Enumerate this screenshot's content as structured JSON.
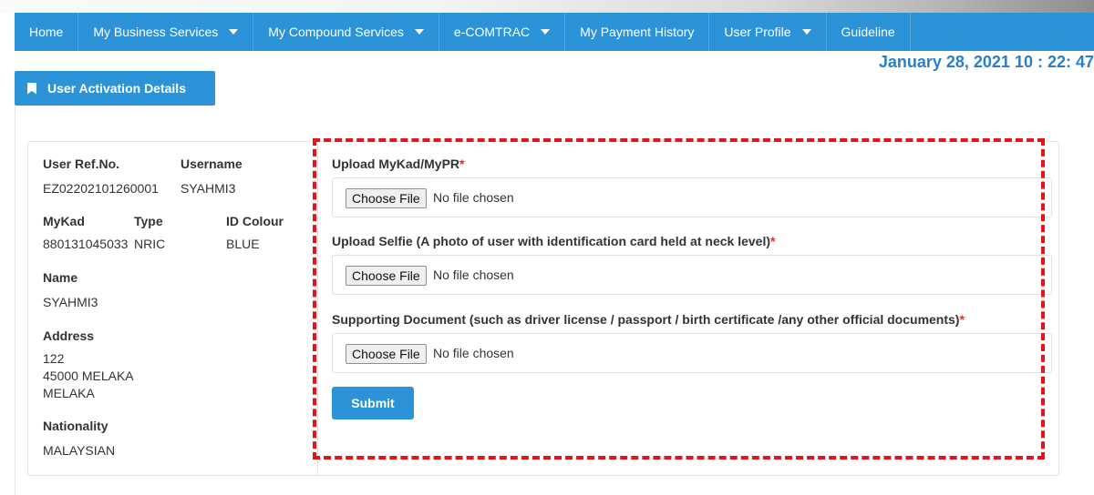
{
  "nav": {
    "items": [
      {
        "label": "Home",
        "dropdown": false
      },
      {
        "label": "My Business Services",
        "dropdown": true
      },
      {
        "label": "My Compound Services",
        "dropdown": true
      },
      {
        "label": "e-COMTRAC",
        "dropdown": true
      },
      {
        "label": "My Payment History",
        "dropdown": false
      },
      {
        "label": "User Profile",
        "dropdown": true
      },
      {
        "label": "Guideline",
        "dropdown": false
      }
    ]
  },
  "datetime": "January 28, 2021 10 : 22: 47",
  "tab": {
    "label": "User Activation Details"
  },
  "user": {
    "ref_label": "User Ref.No.",
    "ref_value": "EZ02202101260001",
    "username_label": "Username",
    "username_value": "SYAHMI3",
    "mykad_label": "MyKad",
    "mykad_value": "880131045033",
    "type_label": "Type",
    "type_value": "NRIC",
    "idcolour_label": "ID Colour",
    "idcolour_value": "BLUE",
    "name_label": "Name",
    "name_value": "SYAHMI3",
    "address_label": "Address",
    "address_line1": "122",
    "address_line2": "45000 MELAKA",
    "address_line3": "MELAKA",
    "nationality_label": "Nationality",
    "nationality_value": "MALAYSIAN"
  },
  "uploads": [
    {
      "label": "Upload MyKad/MyPR",
      "button": "Choose File",
      "status": "No file chosen"
    },
    {
      "label": "Upload Selfie (A photo of user with identification card held at neck level)",
      "button": "Choose File",
      "status": "No file chosen"
    },
    {
      "label": "Supporting Document (such as driver license / passport / birth certificate /any other official documents)",
      "button": "Choose File",
      "status": "No file chosen"
    }
  ],
  "required_mark": "*",
  "submit_label": "Submit",
  "colors": {
    "primary": "#2d93d8",
    "date": "#2c7fc7",
    "required": "#d9302a",
    "highlight": "#e3141b"
  }
}
